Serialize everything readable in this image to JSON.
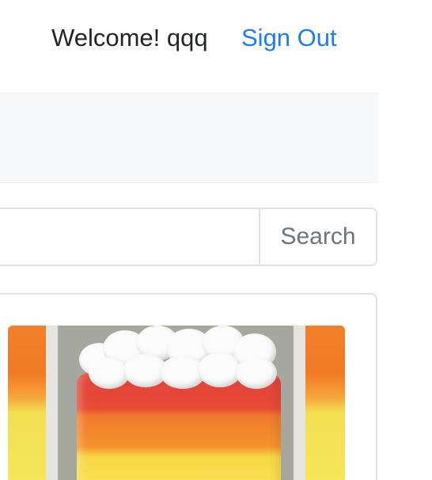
{
  "header": {
    "welcome_text": "Welcome! qqq",
    "sign_out_label": "Sign Out"
  },
  "search": {
    "value": "",
    "placeholder": "",
    "button_label": "Search"
  },
  "card": {
    "image_alt": "cake-image"
  },
  "colors": {
    "link": "#1e7cf2",
    "text": "#212529",
    "muted": "#6c757d",
    "panel": "#f7f8f9",
    "border": "#dfe2e5"
  }
}
